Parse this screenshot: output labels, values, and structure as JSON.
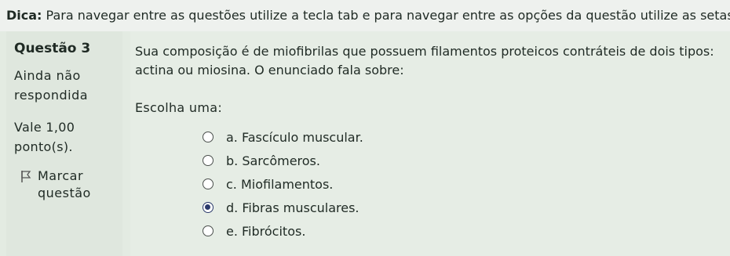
{
  "tip": {
    "label": "Dica:",
    "text": "Para navegar entre as questões utilize a tecla tab e para navegar entre as opções da questão utilize as setas."
  },
  "sidebar": {
    "question_number": "Questão 3",
    "status_line1": "Ainda não",
    "status_line2": "respondida",
    "grade_line1": "Vale 1,00",
    "grade_line2": "ponto(s).",
    "flag_line1": "Marcar",
    "flag_line2": "questão",
    "flag_icon": "flag-icon"
  },
  "question": {
    "text": "Sua composição é de miofibrilas que possuem filamentos proteicos contráteis de dois tipos: actina ou miosina. O enunciado fala sobre:",
    "prompt": "Escolha uma:",
    "options": [
      {
        "label": "a. Fascículo muscular.",
        "selected": false
      },
      {
        "label": "b. Sarcômeros.",
        "selected": false
      },
      {
        "label": "c. Miofilamentos.",
        "selected": false
      },
      {
        "label": "d. Fibras musculares.",
        "selected": true
      },
      {
        "label": "e. Fibrócitos.",
        "selected": false
      }
    ]
  }
}
